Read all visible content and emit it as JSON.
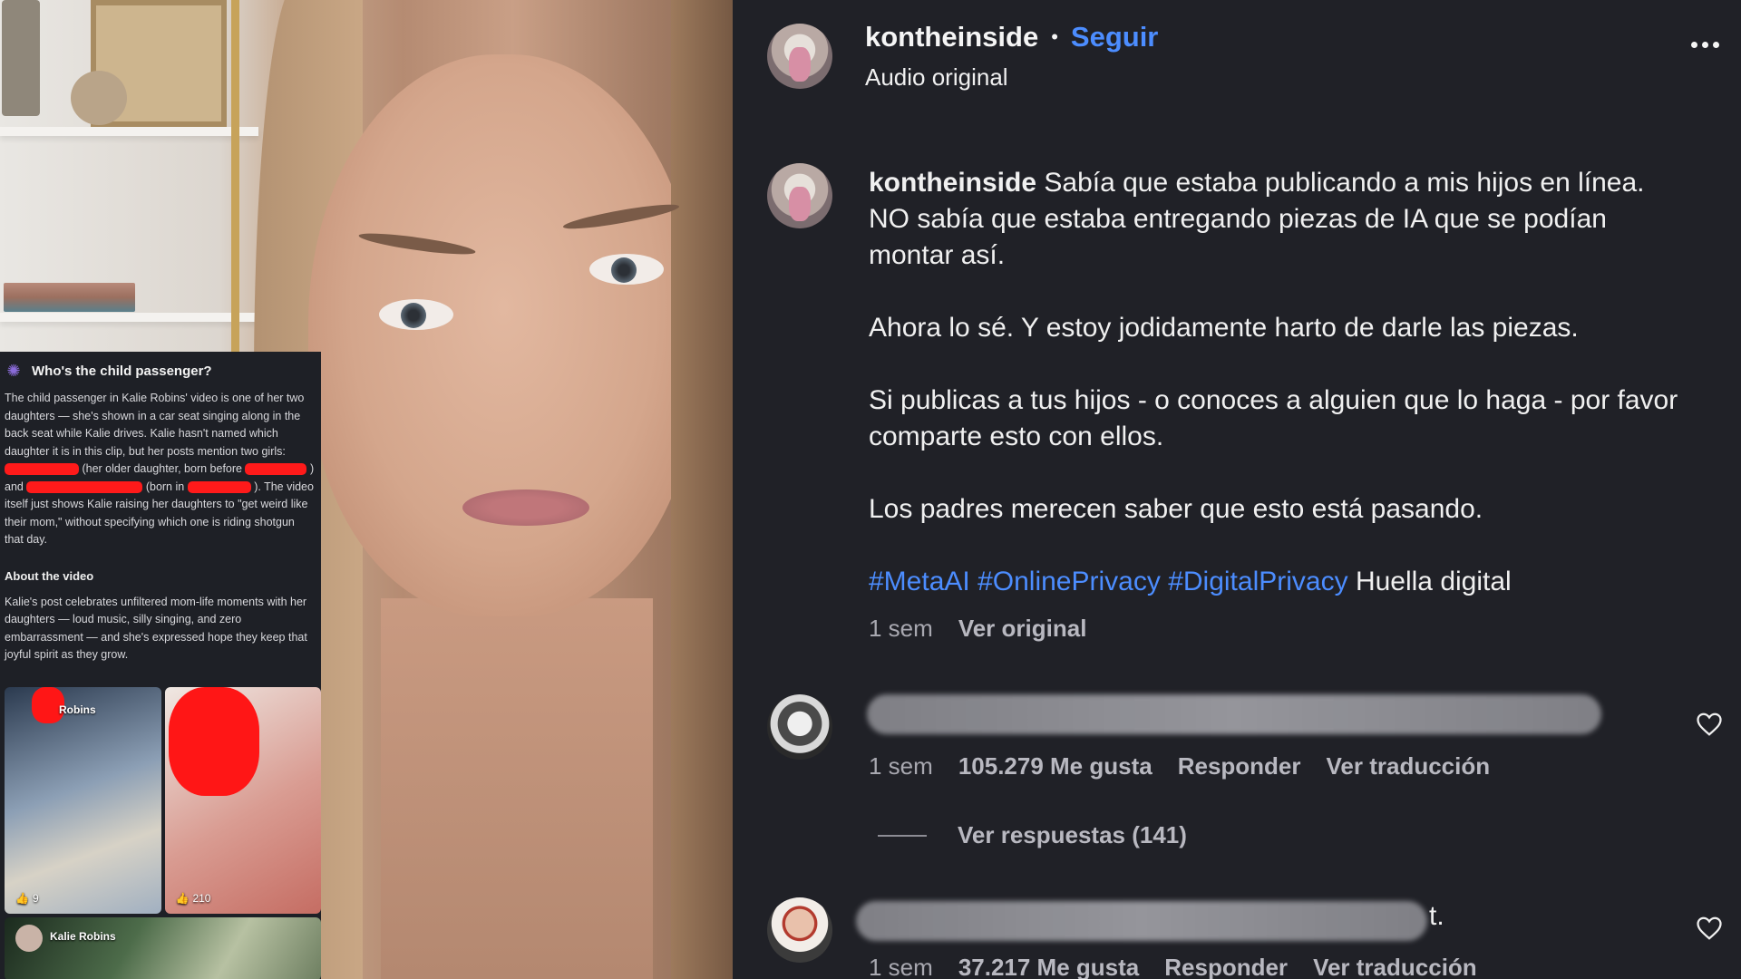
{
  "overlay": {
    "title": "Who's the child passenger?",
    "body_1": "The child passenger in Kalie Robins' video is one of her two daughters — she's shown in a car seat singing along in the back seat while Kalie drives. Kalie hasn't named which daughter it is in this clip, but her posts mention two girls:",
    "body_2": "(her older daughter, born before",
    "body_3": ") and",
    "body_4": "(born in",
    "body_5": "). The video itself just shows Kalie raising her daughters to \"get weird like their mom,\" without specifying which one is riding shotgun that day.",
    "subheading": "About the video",
    "about": "Kalie's post celebrates unfiltered mom-life moments with her daughters — loud music, silly singing, and zero embarrassment — and she's expressed hope they keep that joyful spirit as they grow.",
    "thumb1_name": "Robins",
    "thumb1_likes": "9",
    "thumb2_likes": "210",
    "thumb3_name": "Kalie Robins"
  },
  "header": {
    "username": "kontheinside",
    "separator": "•",
    "follow": "Seguir",
    "audio": "Audio original"
  },
  "caption": {
    "username": "kontheinside",
    "line1": "Sabía que estaba publicando a mis hijos en línea. NO sabía que estaba entregando piezas de IA que se podían montar así.",
    "line2": "Ahora lo sé. Y estoy jodidamente harto de darle las piezas.",
    "line3": "Si publicas a tus hijos - o conoces a alguien que lo haga - por favor comparte esto con ellos.",
    "line4": "Los padres merecen saber que esto está pasando.",
    "hashtags": [
      "#MetaAI",
      "#OnlinePrivacy",
      "#DigitalPrivacy"
    ],
    "tail": "Huella digital",
    "time": "1 sem",
    "see_original": "Ver original"
  },
  "comments": [
    {
      "time": "1 sem",
      "likes": "105.279 Me gusta",
      "reply": "Responder",
      "translate": "Ver traducción",
      "view_replies": "Ver respuestas (141)"
    },
    {
      "visible_tail": "t.",
      "time": "1 sem",
      "likes": "37.217 Me gusta",
      "reply": "Responder",
      "translate": "Ver traducción"
    }
  ],
  "icons": {
    "more": "more-options-icon",
    "like": "heart-icon",
    "overlay": "sparkle-icon"
  },
  "colors": {
    "accent_link": "#4c8dff",
    "panel_bg": "#202127",
    "redaction": "#ff1a1a"
  }
}
